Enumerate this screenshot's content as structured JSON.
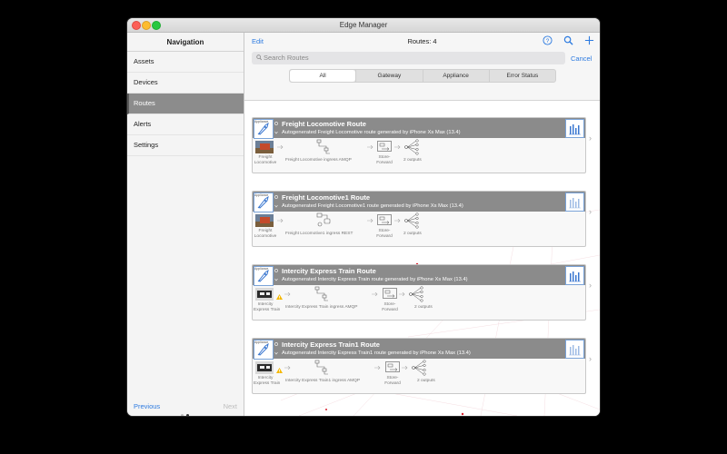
{
  "window": {
    "title": "Edge Manager"
  },
  "sidebar": {
    "header": "Navigation",
    "items": [
      {
        "label": "Assets",
        "active": false
      },
      {
        "label": "Devices",
        "active": false
      },
      {
        "label": "Routes",
        "active": true
      },
      {
        "label": "Alerts",
        "active": false
      },
      {
        "label": "Settings",
        "active": false
      }
    ],
    "footer": {
      "previous": "Previous",
      "next": "Next",
      "page_count": 2,
      "current_page": 2
    }
  },
  "toolbar": {
    "edit": "Edit",
    "title": "Routes: 4",
    "icons": [
      "help-icon",
      "search-icon",
      "add-icon"
    ]
  },
  "search": {
    "placeholder": "Search Routes",
    "cancel": "Cancel"
  },
  "filters": {
    "tabs": [
      "All",
      "Gateway",
      "Appliance",
      "Error Status"
    ],
    "selected": "All"
  },
  "routes": [
    {
      "badge": "Appliance",
      "title": "Freight Locomotive Route",
      "subtitle": "Autogenerated Freight Locomotive route generated by iPhone Xs Max (13.4)",
      "asset_label_1": "Freight",
      "asset_label_2": "Locomotive",
      "ingress": "Freight Locomotive ingress AMQP",
      "store_1": "Store-",
      "store_2": "Forward",
      "outputs": "2 outputs",
      "warning": false
    },
    {
      "badge": "Appliance",
      "title": "Freight Locomotive1 Route",
      "subtitle": "Autogenerated Freight Locomotive1 route generated by iPhone Xs Max (13.4)",
      "asset_label_1": "Freight",
      "asset_label_2": "Locomotive",
      "ingress": "Freight Locomotive1 ingress REST",
      "store_1": "Store-",
      "store_2": "Forward",
      "outputs": "2 outputs",
      "warning": false
    },
    {
      "badge": "Appliance",
      "title": "Intercity Express Train Route",
      "subtitle": "Autogenerated Intercity Express Train route generated by iPhone Xs Max (13.4)",
      "asset_label_1": "Intercity",
      "asset_label_2": "Express Train",
      "ingress": "Intercity Express Train ingress AMQP",
      "store_1": "Store-",
      "store_2": "Forward",
      "outputs": "2 outputs",
      "warning": true
    },
    {
      "badge": "Appliance",
      "title": "Intercity Express Train1 Route",
      "subtitle": "Autogenerated Intercity Express Train1 route generated by iPhone Xs Max (13.4)",
      "asset_label_1": "Intercity",
      "asset_label_2": "Express Train",
      "ingress": "Intercity Express Train1 ingress AMQP",
      "store_1": "Store-",
      "store_2": "Forward",
      "outputs": "2 outputs",
      "warning": true
    }
  ],
  "colors": {
    "accent": "#2d7be0",
    "card_header": "#8b8b8b",
    "selected_nav": "#8c8c8c",
    "warning": "#f5b800"
  }
}
